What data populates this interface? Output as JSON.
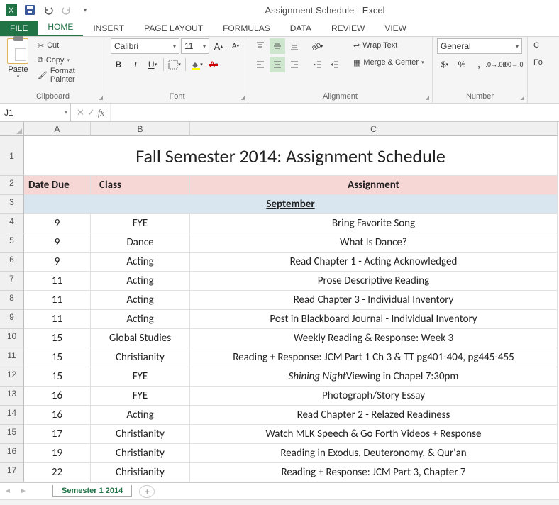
{
  "app": {
    "title": "Assignment Schedule - Excel"
  },
  "tabs": {
    "file": "FILE",
    "items": [
      "HOME",
      "INSERT",
      "PAGE LAYOUT",
      "FORMULAS",
      "DATA",
      "REVIEW",
      "VIEW"
    ],
    "active": 0
  },
  "ribbon": {
    "clipboard": {
      "paste": "Paste",
      "cut": "Cut",
      "copy": "Copy",
      "format_painter": "Format Painter",
      "label": "Clipboard"
    },
    "font": {
      "name": "Calibri",
      "size": "11",
      "label": "Font"
    },
    "alignment": {
      "wrap": "Wrap Text",
      "merge": "Merge & Center",
      "label": "Alignment"
    },
    "number": {
      "format": "General",
      "label": "Number"
    },
    "cells_partial": {
      "c": "C",
      "fo": "Fo"
    }
  },
  "formula": {
    "namebox": "J1",
    "fx": "fx"
  },
  "columns": [
    "A",
    "B",
    "C"
  ],
  "sheet": {
    "title": "Fall Semester 2014: Assignment Schedule",
    "headers": {
      "date": "Date Due",
      "class": "Class",
      "assignment": "Assignment"
    },
    "month": "September",
    "rows": [
      {
        "n": 4,
        "date": "9",
        "class": "FYE",
        "assign": "Bring Favorite Song"
      },
      {
        "n": 5,
        "date": "9",
        "class": "Dance",
        "assign": "What Is Dance?"
      },
      {
        "n": 6,
        "date": "9",
        "class": "Acting",
        "assign": "Read Chapter 1 - Acting Acknowledged"
      },
      {
        "n": 7,
        "date": "11",
        "class": "Acting",
        "assign": "Prose Descriptive Reading"
      },
      {
        "n": 8,
        "date": "11",
        "class": "Acting",
        "assign": "Read Chapter 3 - Individual Inventory"
      },
      {
        "n": 9,
        "date": "11",
        "class": "Acting",
        "assign": "Post in Blackboard Journal - Individual Inventory"
      },
      {
        "n": 10,
        "date": "15",
        "class": "Global Studies",
        "assign": "Weekly Reading & Response: Week 3"
      },
      {
        "n": 11,
        "date": "15",
        "class": "Christianity",
        "assign": "Reading + Response: JCM Part 1 Ch 3 & TT pg401-404, pg445-455"
      },
      {
        "n": 12,
        "date": "15",
        "class": "FYE",
        "assign_pre": "Shining Night",
        "assign_post": "  Viewing in Chapel 7:30pm",
        "special": "italic"
      },
      {
        "n": 13,
        "date": "16",
        "class": "FYE",
        "assign": "Photograph/Story Essay"
      },
      {
        "n": 14,
        "date": "16",
        "class": "Acting",
        "assign": "Read Chapter 2 - Relazed Readiness"
      },
      {
        "n": 15,
        "date": "17",
        "class": "Christianity",
        "assign": "Watch MLK Speech & Go Forth Videos + Response"
      },
      {
        "n": 16,
        "date": "19",
        "class": "Christianity",
        "assign": "Reading in Exodus, Deuteronomy, & Qur'an"
      },
      {
        "n": 17,
        "date": "22",
        "class": "Christianity",
        "assign": "Reading + Response: JCM Part 3, Chapter 7"
      }
    ]
  },
  "tabs_bottom": {
    "sheet": "Semester 1 2014"
  }
}
